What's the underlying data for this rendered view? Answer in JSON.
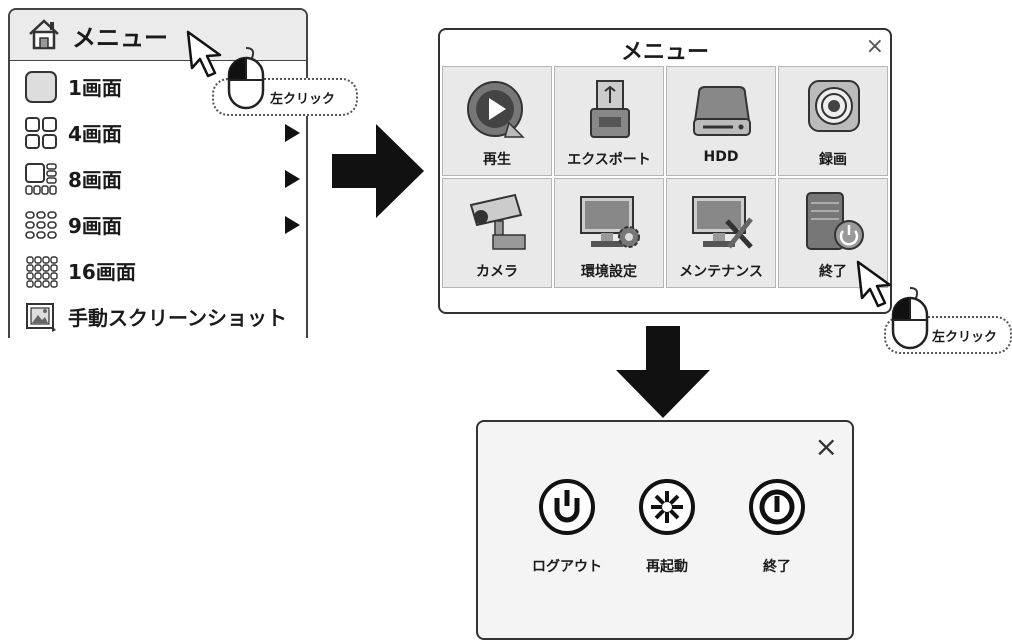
{
  "left_menu": {
    "title": "メニュー",
    "items": [
      {
        "label": "1画面",
        "icon": "single-screen-icon",
        "submenu": false
      },
      {
        "label": "4画面",
        "icon": "quad-screen-icon",
        "submenu": true
      },
      {
        "label": "8画面",
        "icon": "eight-screen-icon",
        "submenu": true
      },
      {
        "label": "9画面",
        "icon": "nine-screen-icon",
        "submenu": true
      },
      {
        "label": "16画面",
        "icon": "sixteen-screen-icon",
        "submenu": false
      },
      {
        "label": "手動スクリーンショット",
        "icon": "screenshot-icon",
        "submenu": false
      }
    ]
  },
  "click_hint": {
    "label": "左クリック"
  },
  "menu_window": {
    "title": "メニュー",
    "close": "×",
    "tiles": [
      {
        "label": "再生",
        "icon": "playback-icon"
      },
      {
        "label": "エクスポート",
        "icon": "usb-export-icon"
      },
      {
        "label": "HDD",
        "icon": "hdd-icon"
      },
      {
        "label": "録画",
        "icon": "record-icon"
      },
      {
        "label": "カメラ",
        "icon": "camera-icon"
      },
      {
        "label": "環境設定",
        "icon": "settings-icon"
      },
      {
        "label": "メンテナンス",
        "icon": "maintenance-icon"
      },
      {
        "label": "終了",
        "icon": "shutdown-icon"
      }
    ]
  },
  "power_dialog": {
    "close": "×",
    "buttons": [
      {
        "label": "ログアウト",
        "icon": "logout-icon"
      },
      {
        "label": "再起動",
        "icon": "restart-icon"
      },
      {
        "label": "終了",
        "icon": "shutdown-icon"
      }
    ]
  },
  "colors": {
    "border": "#333333",
    "tile_bg": "#e9e9e9",
    "header_bg": "#ebebeb",
    "arrow": "#111111"
  }
}
